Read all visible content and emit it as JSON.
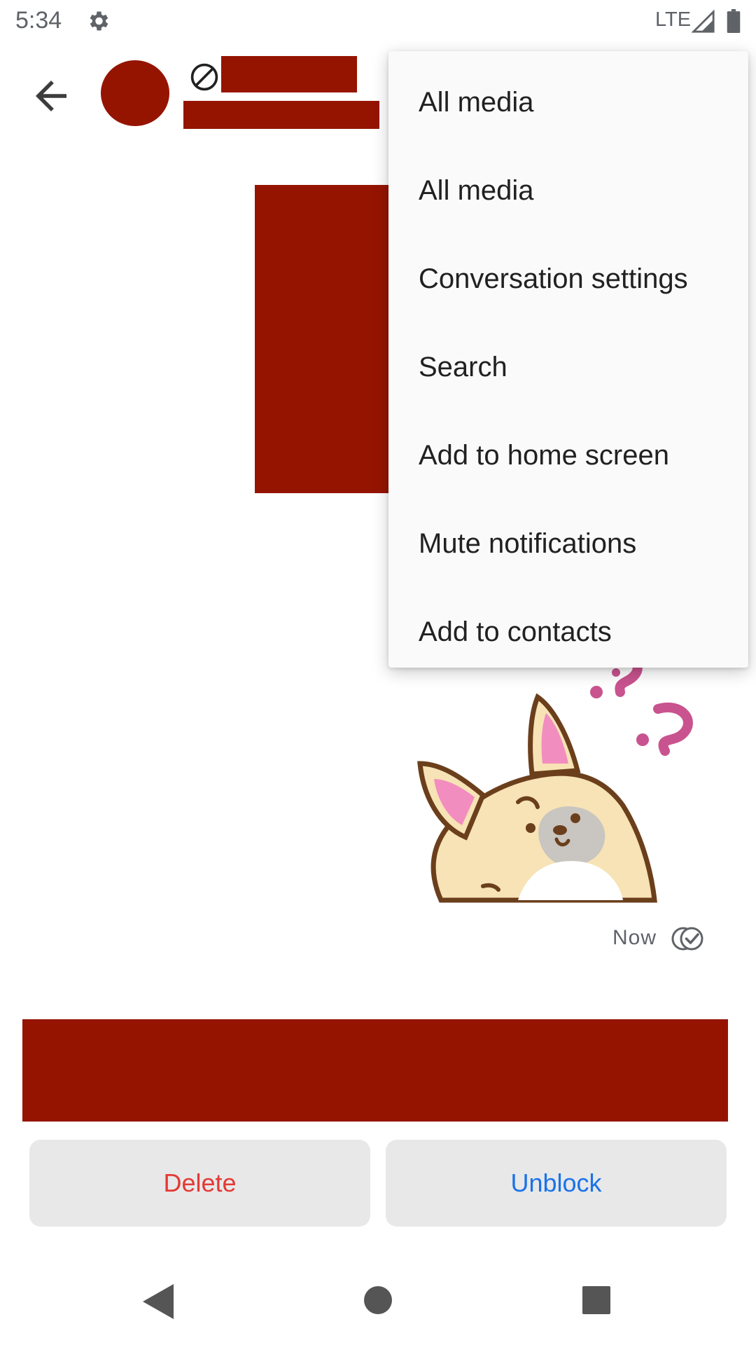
{
  "status_bar": {
    "time": "5:34",
    "network": "LTE",
    "icons": [
      "gear-icon",
      "signal-icon",
      "battery-icon"
    ]
  },
  "toolbar": {
    "back_icon": "arrow-back-icon",
    "blocked_icon": "blocked-icon"
  },
  "conversation": {
    "message_time": "Now",
    "status_icon": "delivered-icon"
  },
  "actions": {
    "delete_label": "Delete",
    "unblock_label": "Unblock"
  },
  "overflow_menu": {
    "items": [
      {
        "label": "All media"
      },
      {
        "label": "All media"
      },
      {
        "label": "Conversation settings"
      },
      {
        "label": "Search"
      },
      {
        "label": "Add to home screen"
      },
      {
        "label": "Mute notifications"
      },
      {
        "label": "Add to contacts"
      }
    ]
  },
  "colors": {
    "redaction": "#951400",
    "delete": "#e53935",
    "unblock": "#1a73e8",
    "menu_bg": "#fafafa",
    "button_bg": "#e8e8e8"
  }
}
